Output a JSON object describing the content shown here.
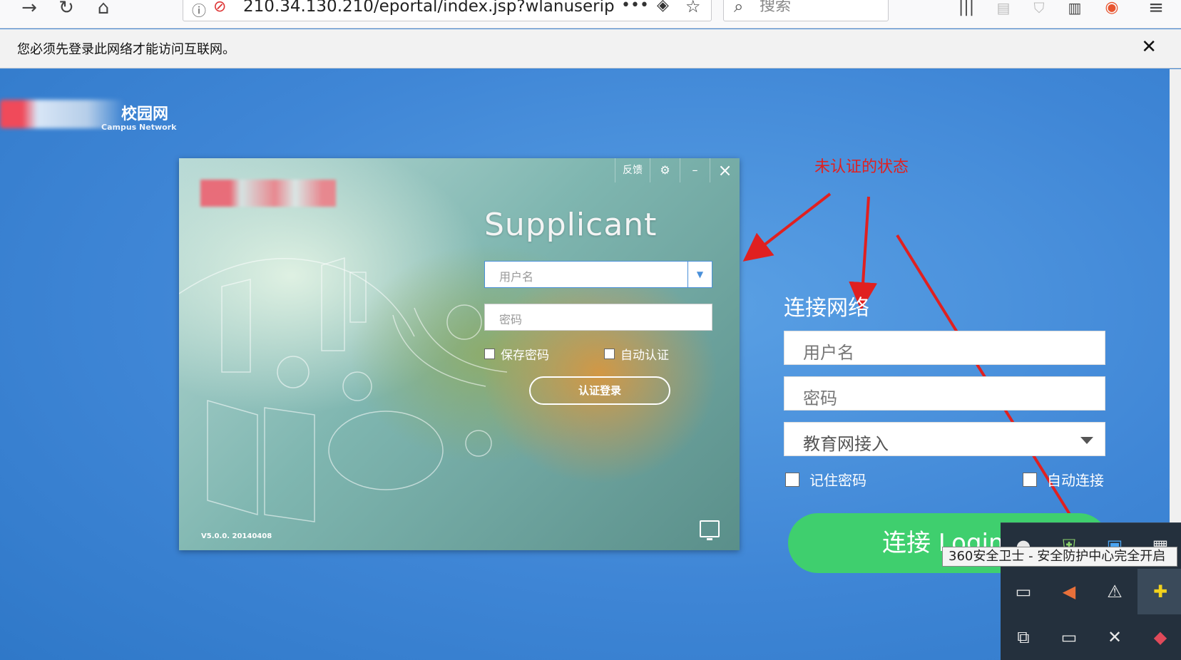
{
  "browser": {
    "url": "210.34.130.210/eportal/index.jsp?wlanuserip",
    "search_placeholder": "搜索"
  },
  "notification": {
    "message": "您必须先登录此网络才能访问互联网。",
    "close_glyph": "✕"
  },
  "campus": {
    "name": "校园网",
    "name_en": "Campus Network"
  },
  "supplicant": {
    "title": "Supplicant",
    "feedback_label": "反馈",
    "username_placeholder": "用户名",
    "password_placeholder": "密码",
    "save_password_label": "保存密码",
    "auto_auth_label": "自动认证",
    "login_button": "认证登录",
    "version": "V5.0.0. 20140408"
  },
  "annotation": {
    "text": "未认证的状态",
    "color": "#e02020"
  },
  "web_login": {
    "title": "连接网络",
    "username_placeholder": "用户名",
    "password_placeholder": "密码",
    "access_type": "教育网接入",
    "remember_label": "记住密码",
    "auto_connect_label": "自动连接",
    "connect_button": "连接 Login"
  },
  "tray": {
    "tooltip": "360安全卫士 - 安全防护中心完全开启"
  },
  "colors": {
    "page_bg": "#3f87d6",
    "connect_button": "#3fcf6e",
    "tray_bg": "#24303d"
  }
}
